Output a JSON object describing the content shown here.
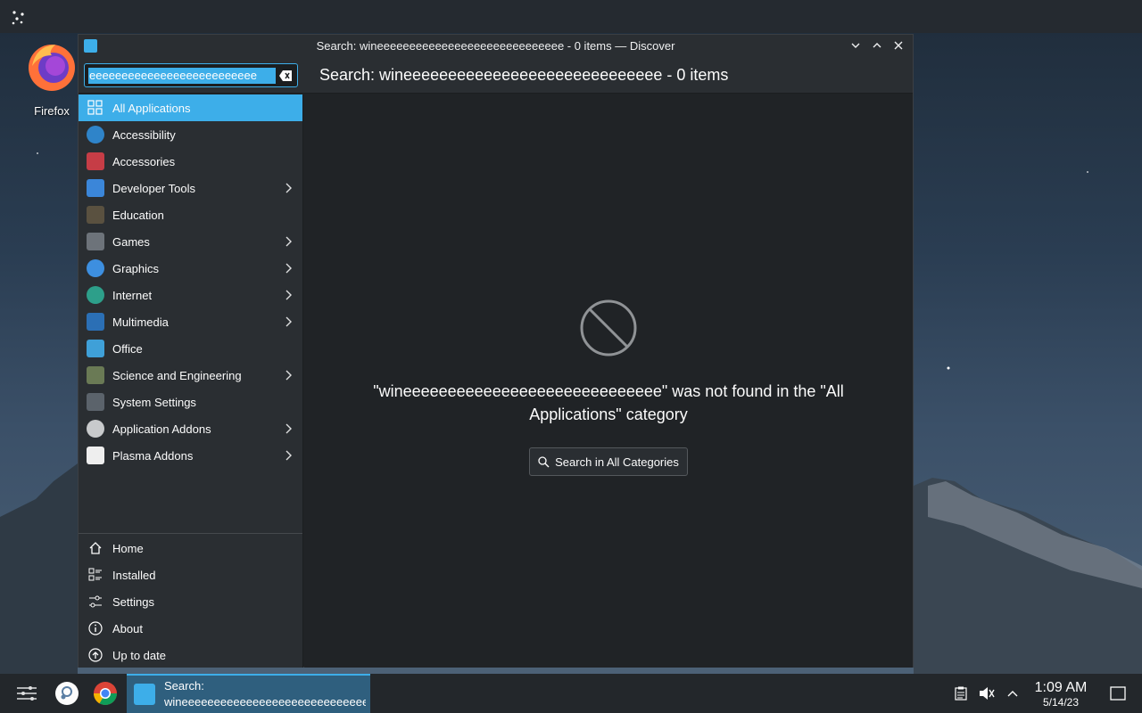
{
  "desktop": {
    "firefox_label": "Firefox"
  },
  "window": {
    "title": "Search: wineeeeeeeeeeeeeeeeeeeeeeeeeeeee - 0 items — Discover",
    "search_value": "eeeeeeeeeeeeeeeeeeeeeeeeee",
    "page_title": "Search: wineeeeeeeeeeeeeeeeeeeeeeeeeeeee - 0 items"
  },
  "categories": [
    {
      "label": "All Applications",
      "icon": "grid-icon",
      "color": "#3daee9",
      "active": true,
      "submenu": false
    },
    {
      "label": "Accessibility",
      "icon": "accessibility-icon",
      "color": "#2f84c9",
      "submenu": false
    },
    {
      "label": "Accessories",
      "icon": "toolbox-icon",
      "color": "#c63d46",
      "submenu": false
    },
    {
      "label": "Developer Tools",
      "icon": "wrench-icon",
      "color": "#3b86d9",
      "submenu": true
    },
    {
      "label": "Education",
      "icon": "chalkboard-icon",
      "color": "#5a5140",
      "submenu": false
    },
    {
      "label": "Games",
      "icon": "gamepad-icon",
      "color": "#6d737a",
      "submenu": true
    },
    {
      "label": "Graphics",
      "icon": "graphics-icon",
      "color": "#3d8fe0",
      "submenu": true
    },
    {
      "label": "Internet",
      "icon": "globe-icon",
      "color": "#2d9f8a",
      "submenu": true
    },
    {
      "label": "Multimedia",
      "icon": "monitor-icon",
      "color": "#2b6fb5",
      "submenu": true
    },
    {
      "label": "Office",
      "icon": "office-icon",
      "color": "#3fa0d8",
      "submenu": false
    },
    {
      "label": "Science and Engineering",
      "icon": "flask-icon",
      "color": "#6a7a55",
      "submenu": true
    },
    {
      "label": "System Settings",
      "icon": "settings-panel-icon",
      "color": "#5b636b",
      "submenu": false
    },
    {
      "label": "Application Addons",
      "icon": "addons-icon",
      "color": "#c8cacc",
      "submenu": true
    },
    {
      "label": "Plasma Addons",
      "icon": "plasma-icon",
      "color": "#eeeeee",
      "submenu": true
    }
  ],
  "nav": [
    {
      "label": "Home",
      "icon": "home-icon"
    },
    {
      "label": "Installed",
      "icon": "installed-icon"
    },
    {
      "label": "Settings",
      "icon": "sliders-icon"
    },
    {
      "label": "About",
      "icon": "info-icon"
    },
    {
      "label": "Up to date",
      "icon": "update-icon"
    }
  ],
  "content": {
    "message": "\"wineeeeeeeeeeeeeeeeeeeeeeeeeeeee\" was not found in the \"All Applications\" category",
    "search_all_label": "Search in All Categories"
  },
  "taskbar": {
    "task_line1": "Search:",
    "task_line2": "wineeeeeeeeeeeeeeeeeeeeeeeeeeeee...",
    "time": "1:09 AM",
    "date": "5/14/23"
  },
  "colors": {
    "accent": "#3daee9",
    "window_bg": "#202326",
    "sidebar_bg": "#2a2e32"
  }
}
